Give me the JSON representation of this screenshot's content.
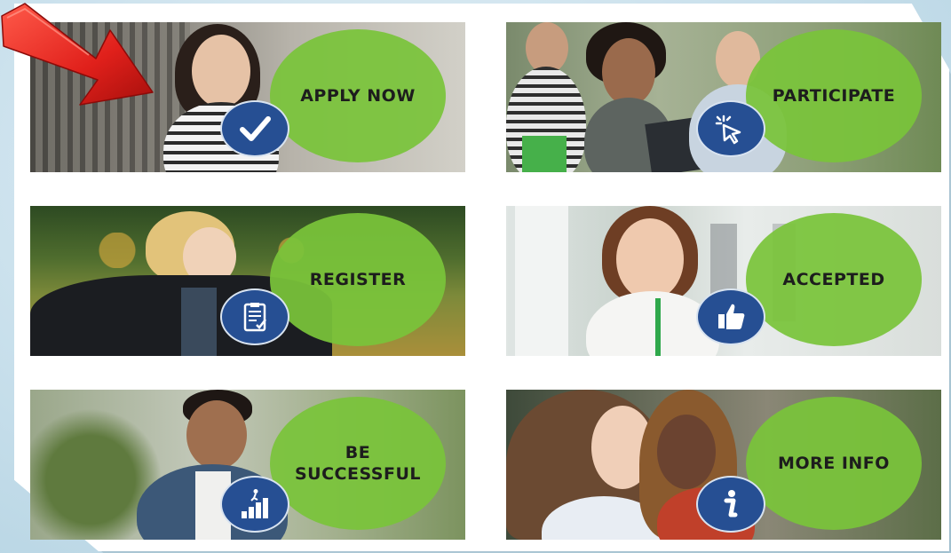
{
  "cards": [
    {
      "label": "APPLY NOW",
      "icon": "checkmark-icon"
    },
    {
      "label": "PARTICIPATE",
      "icon": "cursor-click-icon"
    },
    {
      "label": "REGISTER",
      "icon": "clipboard-check-icon"
    },
    {
      "label": "ACCEPTED",
      "icon": "thumbs-up-icon"
    },
    {
      "label": "BE\nSUCCESSFUL",
      "icon": "stairs-climb-icon"
    },
    {
      "label": "MORE INFO",
      "icon": "info-icon"
    }
  ],
  "colors": {
    "circle_green": "#7ac43a",
    "badge_blue": "#264f93",
    "arrow_red": "#e0201b",
    "background": "#c9e0ec"
  }
}
